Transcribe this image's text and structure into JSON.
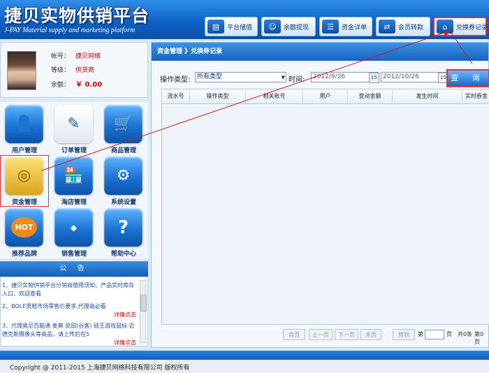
{
  "header": {
    "title": "捷贝实物供销平台",
    "subtitle": "J-PAY Material supply and marketing platform",
    "buttons": [
      {
        "label": "平台储值",
        "icon": "id-card-icon"
      },
      {
        "label": "余额提现",
        "icon": "person-icon"
      },
      {
        "label": "资金详单",
        "icon": "document-icon"
      },
      {
        "label": "会员转款",
        "icon": "transfer-icon"
      },
      {
        "label": "兑换券记录",
        "icon": "home-document-icon"
      }
    ]
  },
  "user": {
    "account_label": "帐号：",
    "account_value": "捷贝网络",
    "level_label": "等级：",
    "level_value": "供货商",
    "balance_label": "余额：",
    "balance_value": "￥ 0.00"
  },
  "tiles": [
    {
      "label": "用户管理",
      "icon": "user-icon"
    },
    {
      "label": "订单管理",
      "icon": "order-icon"
    },
    {
      "label": "商品管理",
      "icon": "cart-icon"
    },
    {
      "label": "资金管理",
      "icon": "coins-icon"
    },
    {
      "label": "淘店管理",
      "icon": "shop-icon"
    },
    {
      "label": "系统设置",
      "icon": "gear-icon"
    },
    {
      "label": "推荐品牌",
      "icon": "hot-icon"
    },
    {
      "label": "销售管理",
      "icon": "sale-tag-icon"
    },
    {
      "label": "帮助中心",
      "icon": "help-icon"
    }
  ],
  "notice": {
    "title": "公 告",
    "items": [
      {
        "text": "1、捷贝实物供销平台分销商使用须知、产品实时库存入口，欢迎查看",
        "more": ""
      },
      {
        "text": "2、BOLE男鞋市场零售价要求,代理商必看",
        "more": "详情点击"
      },
      {
        "text": "3、代理奥尼百脑通 麦典 良田(谷客) 硕王游戏鼠标 迈德克斯摄像头等商品，请上传后在5",
        "more": "详情点击"
      }
    ]
  },
  "main": {
    "breadcrumb": "资金管理 》兑换券记录",
    "filter": {
      "type_label": "操作类型:",
      "type_value": "所有类型",
      "time_label": "时间:",
      "date_from": "2012/9/26",
      "date_to": "2012/10/26",
      "query_label": "查 询"
    },
    "columns": [
      "流水号",
      "操作类型",
      "相关账号",
      "用户",
      "变动金额",
      "发生时间",
      "实时券金"
    ],
    "pager": {
      "first": "首页",
      "prev": "上一页",
      "next": "下一页",
      "last": "末页",
      "goto": "转到",
      "page_prefix": "第",
      "page_suffix": "页",
      "total": "共0条",
      "page_of": "第0页"
    }
  },
  "footer": {
    "copyright": "Copyright @ 2011-2015 上海捷贝网络科技有限公司 版权所有"
  },
  "colors": {
    "header_blue": "#0d62c7",
    "highlight_red": "#e23232",
    "accent_text_red": "#d20000"
  }
}
